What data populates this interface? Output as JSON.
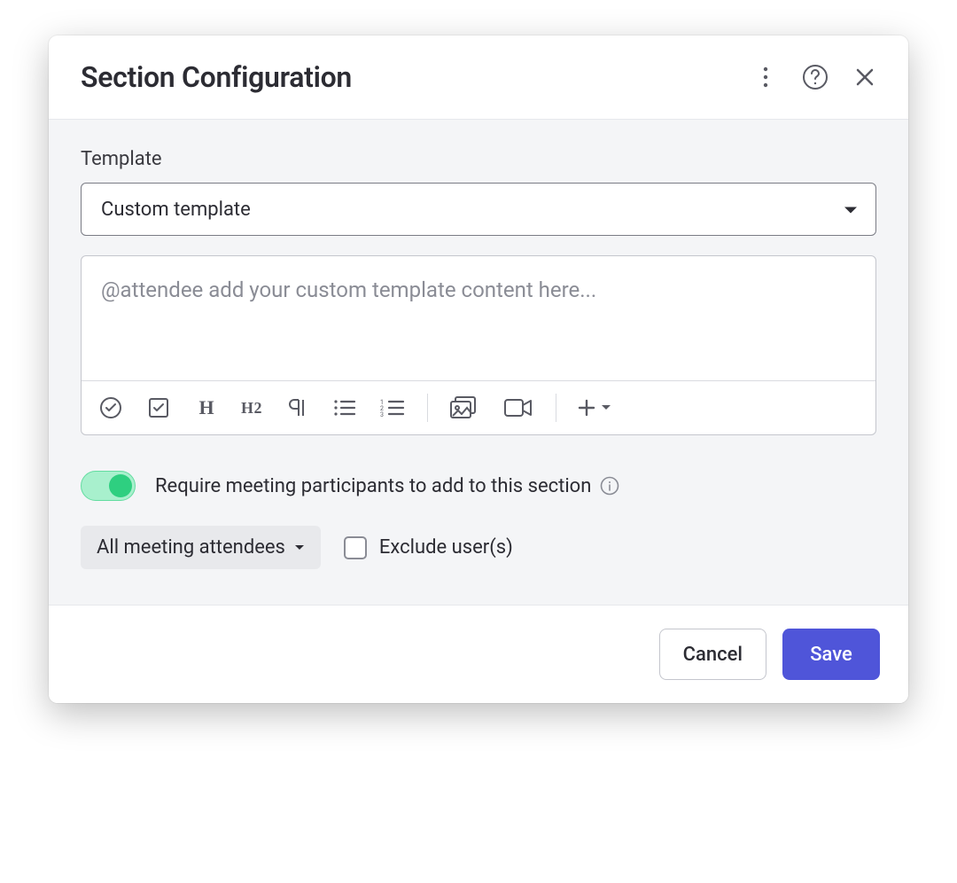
{
  "header": {
    "title": "Section Configuration"
  },
  "body": {
    "template_label": "Template",
    "template_selected": "Custom template",
    "editor_placeholder": "@attendee add your custom template content here...",
    "toggle_label": "Require meeting participants to add to this section",
    "attendees_chip": "All meeting attendees",
    "exclude_label": "Exclude user(s)"
  },
  "footer": {
    "cancel": "Cancel",
    "save": "Save"
  }
}
